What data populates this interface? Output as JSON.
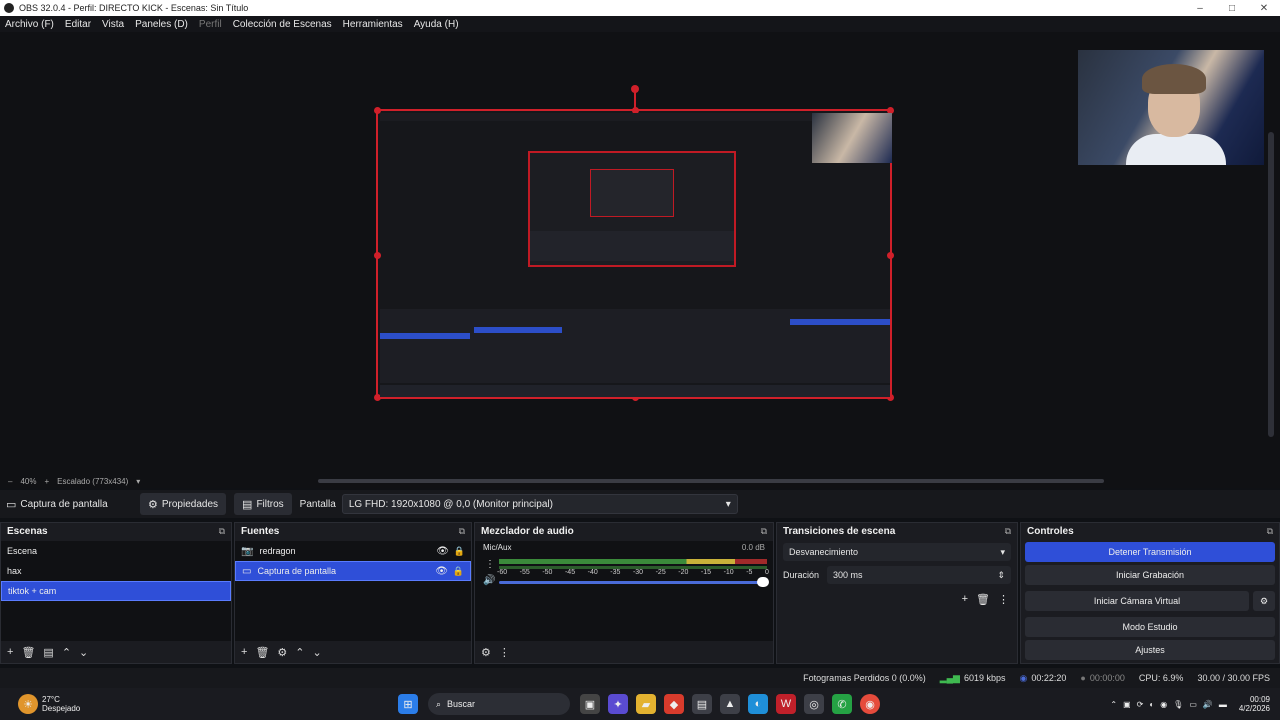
{
  "window": {
    "title": "OBS 32.0.4 - Perfil: DIRECTO KICK - Escenas: Sin Título",
    "controls": [
      "–",
      "□",
      "✕"
    ]
  },
  "menu": [
    "Archivo (F)",
    "Editar",
    "Vista",
    "Paneles (D)",
    "Perfil",
    "Colección de Escenas",
    "Herramientas",
    "Ayuda (H)"
  ],
  "zoom": {
    "minus": "–",
    "level": "40%",
    "plus": "+",
    "scaling": "Escalado (773x434)",
    "dropdown": "▾"
  },
  "source_toolbar": {
    "source_name": "Captura de pantalla",
    "properties": "Propiedades",
    "filters": "Filtros",
    "screen_label": "Pantalla",
    "screen_value": "LG FHD: 1920x1080 @ 0,0 (Monitor principal)"
  },
  "scenes": {
    "title": "Escenas",
    "items": [
      "Escena",
      "hax",
      "tiktok + cam"
    ],
    "selected": 2
  },
  "sources": {
    "title": "Fuentes",
    "items": [
      {
        "name": "redragon",
        "icon": "camera-icon"
      },
      {
        "name": "Captura de pantalla",
        "icon": "monitor-icon"
      }
    ],
    "selected": 1
  },
  "mixer": {
    "title": "Mezclador de audio",
    "track": "Mic/Aux",
    "level": "0.0 dB",
    "ticks": [
      "-60",
      "-55",
      "-50",
      "-45",
      "-40",
      "-35",
      "-30",
      "-25",
      "-20",
      "-15",
      "-10",
      "-5",
      "0"
    ]
  },
  "transitions": {
    "title": "Transiciones de escena",
    "type": "Desvanecimiento",
    "duration_label": "Duración",
    "duration_value": "300 ms"
  },
  "controls": {
    "title": "Controles",
    "stop_stream": "Detener Transmisión",
    "start_recording": "Iniciar Grabación",
    "virtual_camera": "Iniciar Cámara Virtual",
    "studio_mode": "Modo Estudio",
    "settings": "Ajustes"
  },
  "status": {
    "dropped_frames": "Fotogramas Perdidos 0 (0.0%)",
    "bitrate": "6019 kbps",
    "stream_time": "00:22:20",
    "rec_time": "00:00:00",
    "cpu": "CPU: 6.9%",
    "fps": "30.00 / 30.00 FPS"
  },
  "taskbar": {
    "weather_temp": "27°C",
    "weather_desc": "Despejado",
    "search": "Buscar",
    "time": "00:09",
    "date": "4/2/2026"
  },
  "colors": {
    "accent": "#2f4fd8",
    "selection_border": "#d0202a"
  }
}
